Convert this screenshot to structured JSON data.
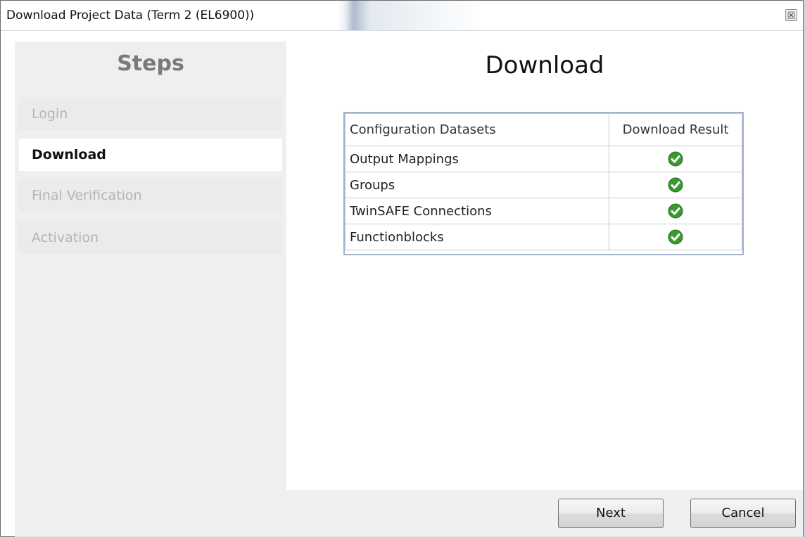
{
  "window": {
    "title": "Download Project Data (Term 2 (EL6900))",
    "close_icon": "close-icon"
  },
  "sidebar": {
    "title": "Steps",
    "items": [
      {
        "label": "Login",
        "state": "inactive"
      },
      {
        "label": "Download",
        "state": "active"
      },
      {
        "label": "Final Verification",
        "state": "inactive"
      },
      {
        "label": "Activation",
        "state": "inactive"
      }
    ]
  },
  "main": {
    "title": "Download",
    "table": {
      "headers": [
        "Configuration Datasets",
        "Download Result"
      ],
      "rows": [
        {
          "dataset": "Output Mappings",
          "result_icon": "check-icon",
          "result": "success"
        },
        {
          "dataset": "Groups",
          "result_icon": "check-icon",
          "result": "success"
        },
        {
          "dataset": "TwinSAFE Connections",
          "result_icon": "check-icon",
          "result": "success"
        },
        {
          "dataset": "Functionblocks",
          "result_icon": "check-icon",
          "result": "success"
        }
      ]
    }
  },
  "footer": {
    "next_label": "Next",
    "cancel_label": "Cancel"
  },
  "colors": {
    "success_green": "#3a9a2e",
    "table_border": "#9fb3cd"
  }
}
